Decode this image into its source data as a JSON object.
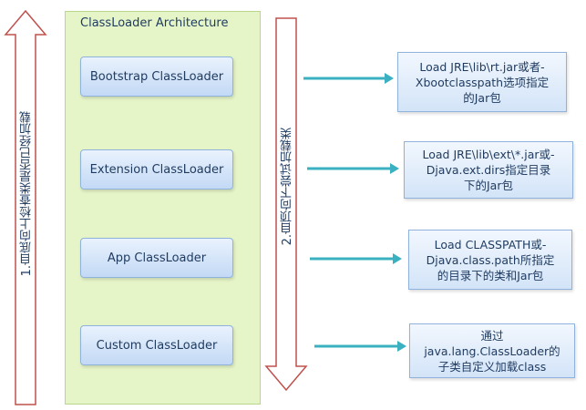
{
  "architecture": {
    "title": "ClassLoader Architecture"
  },
  "loaders": [
    {
      "label": "Bootstrap ClassLoader"
    },
    {
      "label": "Extension ClassLoader"
    },
    {
      "label": "App ClassLoader"
    },
    {
      "label": "Custom ClassLoader"
    }
  ],
  "notes": [
    {
      "text": "Load JRE\\lib\\rt.jar或者-\nXbootclasspath选项指定\n的Jar包"
    },
    {
      "text": "Load JRE\\lib\\ext\\*.jar或-\nDjava.ext.dirs指定目录\n下的Jar包"
    },
    {
      "text": "Load CLASSPATH或-\nDjava.class.path所指定\n的目录下的类和Jar包"
    },
    {
      "text": "通过\njava.lang.ClassLoader的\n子类自定义加载class"
    }
  ],
  "left_arrow": {
    "label": "1.自底向上检查类是否已经加载"
  },
  "middle_arrow": {
    "label": "2.自顶向下尝试加载类"
  },
  "colors": {
    "arrow_fill": "#ffffff",
    "arrow_stroke": "#c0504d",
    "connector": "#3ab0c0"
  }
}
